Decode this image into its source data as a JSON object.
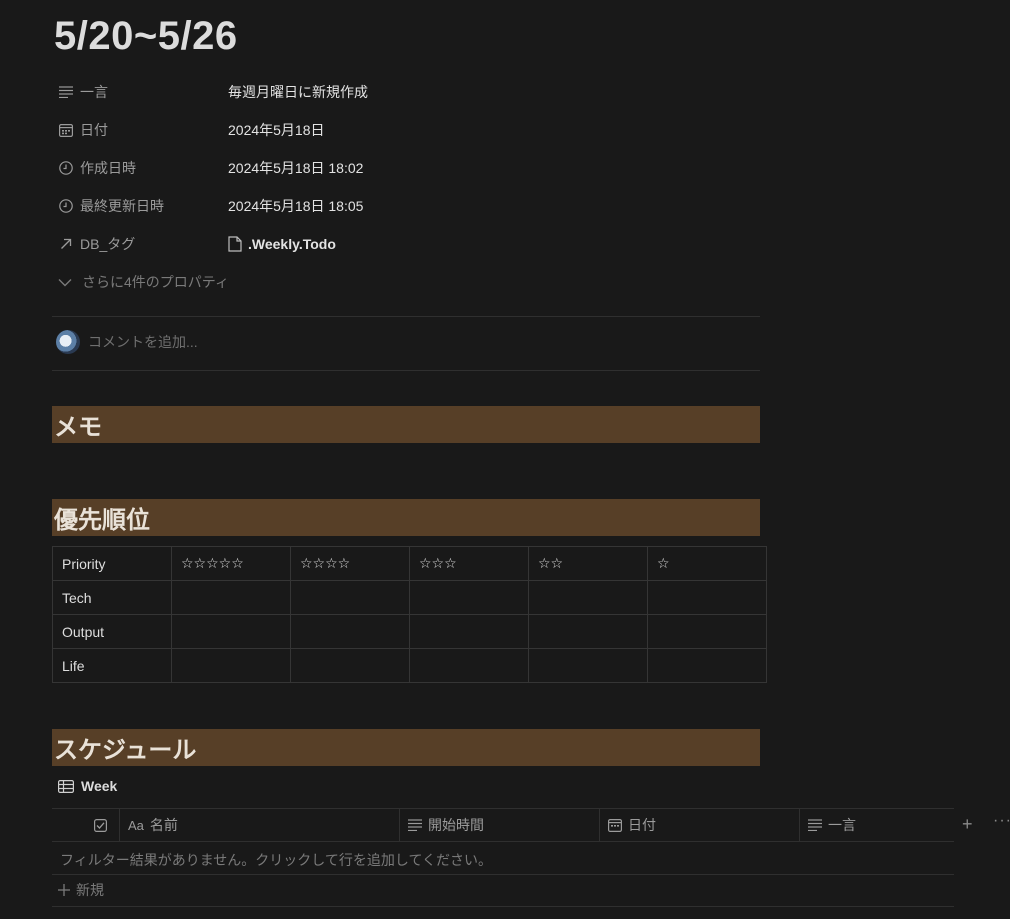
{
  "page": {
    "title": "5/20~5/26"
  },
  "properties": [
    {
      "icon": "text-lines-icon",
      "key": "一言",
      "value": "毎週月曜日に新規作成"
    },
    {
      "icon": "calendar-icon",
      "key": "日付",
      "value": "2024年5月18日"
    },
    {
      "icon": "clock-icon",
      "key": "作成日時",
      "value": "2024年5月18日 18:02"
    },
    {
      "icon": "clock-icon",
      "key": "最終更新日時",
      "value": "2024年5月18日 18:05"
    },
    {
      "icon": "relation-arrow-icon",
      "key": "DB_タグ",
      "value": ".Weekly.Todo"
    }
  ],
  "more_props": "さらに4件のプロパティ",
  "comment": {
    "placeholder": "コメントを追加..."
  },
  "headings": {
    "memo": "メモ",
    "priority": "優先順位",
    "schedule": "スケジュール"
  },
  "priority_table": {
    "header": [
      "Priority",
      "☆☆☆☆☆",
      "☆☆☆☆",
      "☆☆☆",
      "☆☆",
      "☆"
    ],
    "rows": [
      [
        "Tech",
        "",
        "",
        "",
        "",
        ""
      ],
      [
        "Output",
        "",
        "",
        "",
        "",
        ""
      ],
      [
        "Life",
        "",
        "",
        "",
        "",
        ""
      ]
    ]
  },
  "database": {
    "view_label": "Week",
    "columns": [
      {
        "icon": "checkbox-icon",
        "label": ""
      },
      {
        "icon": "title-aa-icon",
        "label": "名前"
      },
      {
        "icon": "text-lines-icon",
        "label": "開始時間"
      },
      {
        "icon": "calendar-icon",
        "label": "日付"
      },
      {
        "icon": "text-lines-icon",
        "label": "一言"
      }
    ],
    "empty_text": "フィルター結果がありません。クリックして行を追加してください。",
    "new_label": "新規",
    "add_column": "+",
    "more": "···"
  }
}
